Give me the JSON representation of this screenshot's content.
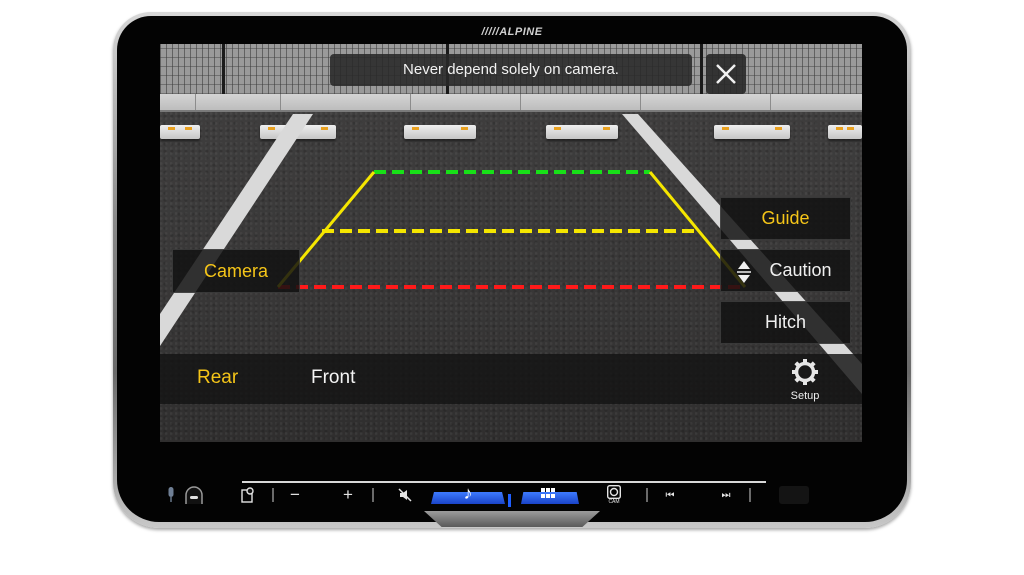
{
  "device": {
    "brand": "/////ALPINE"
  },
  "camera_view": {
    "warning_message": "Never depend solely on camera.",
    "close_button": {
      "icon": "close-icon"
    },
    "guide_lines": {
      "near_color": "#ff1a1a",
      "middle_color": "#f5e600",
      "far_color": "#18e018",
      "side_color": "#f5e600"
    }
  },
  "left_panel": {
    "camera_label": "Camera"
  },
  "right_panel": {
    "buttons": [
      {
        "label": "Guide",
        "active": true
      },
      {
        "label": "Caution",
        "active": false,
        "icon": "up-down-arrows-icon"
      },
      {
        "label": "Hitch",
        "active": false
      }
    ]
  },
  "bottom_bar": {
    "tabs": [
      {
        "label": "Rear",
        "active": true
      },
      {
        "label": "Front",
        "active": false
      }
    ],
    "setup": {
      "label": "Setup",
      "icon": "gear-icon"
    }
  },
  "hardware_buttons": {
    "mic": {
      "icon": "microphone-icon"
    },
    "home": {
      "icon": "home-button-icon"
    },
    "navigation": {
      "icon": "map-pin-icon"
    },
    "volume_down": {
      "label": "−"
    },
    "volume_up": {
      "label": "+"
    },
    "mute": {
      "icon": "mute-icon"
    },
    "audio": {
      "icon": "music-note-icon",
      "label": "♪"
    },
    "menu": {
      "icon": "grid-icon"
    },
    "camera": {
      "icon": "camera-icon",
      "label": "CAM"
    },
    "previous": {
      "label": "⏮"
    },
    "next": {
      "label": "⏭"
    },
    "accent_color": "#2a5cff"
  },
  "colors": {
    "active_text": "#f5c518",
    "inactive_text": "#f4f4f4",
    "panel_bg": "#121212"
  }
}
